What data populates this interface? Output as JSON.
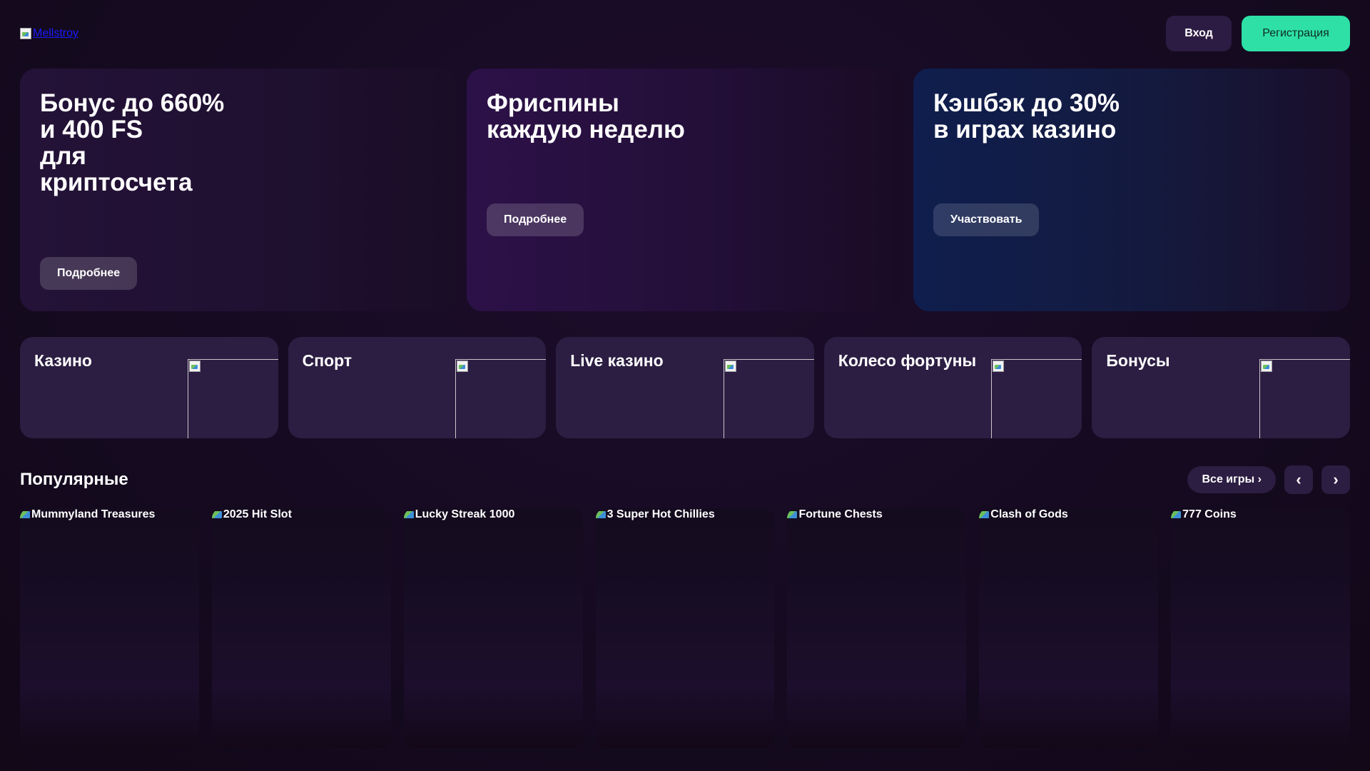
{
  "header": {
    "logo_alt": "Mellstroy",
    "login_label": "Вход",
    "register_label": "Регистрация"
  },
  "promos": [
    {
      "title": "Бонус до 660%\nи 400 FS\nдля\nкриптосчета",
      "button": "Подробнее"
    },
    {
      "title": "Фриспины\nкаждую неделю",
      "button": "Подробнее"
    },
    {
      "title": "Кэшбэк до 30%\nв играх казино",
      "button": "Участвовать"
    }
  ],
  "categories": [
    {
      "label": "Казино"
    },
    {
      "label": "Спорт"
    },
    {
      "label": "Live казино"
    },
    {
      "label": "Колесо фортуны"
    },
    {
      "label": "Бонусы"
    }
  ],
  "popular": {
    "title": "Популярные",
    "all_games_label": "Все игры ›",
    "prev_label": "‹",
    "next_label": "›",
    "games": [
      {
        "name": "Mummyland Treasures"
      },
      {
        "name": "2025 Hit Slot"
      },
      {
        "name": "Lucky Streak 1000"
      },
      {
        "name": "3 Super Hot Chillies"
      },
      {
        "name": "Fortune Chests"
      },
      {
        "name": "Clash of Gods"
      },
      {
        "name": "777 Coins"
      }
    ]
  },
  "colors": {
    "background": "#150a20",
    "register_button": "#2ee0a6",
    "card": "#2c1d42"
  }
}
